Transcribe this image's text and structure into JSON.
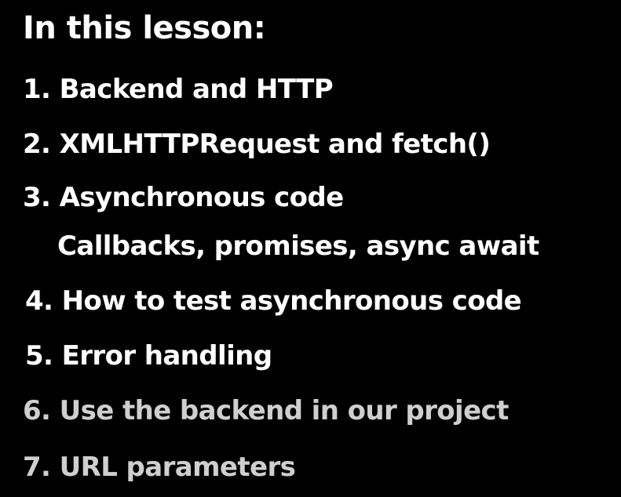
{
  "slide": {
    "title": "In this lesson:",
    "items": [
      {
        "text": "1. Backend and HTTP"
      },
      {
        "text": "2. XMLHTTPRequest and fetch()"
      },
      {
        "text": "3. Asynchronous code",
        "subtext": "Callbacks, promises, async await"
      },
      {
        "text": "4. How to test asynchronous code"
      },
      {
        "text": "5. Error handling"
      },
      {
        "text": "6. Use the backend in our project"
      },
      {
        "text": "7. URL parameters"
      }
    ]
  },
  "colors": {
    "background": "#000000",
    "primary_text": "#ffffff",
    "muted_text": "#cfcfcf"
  }
}
